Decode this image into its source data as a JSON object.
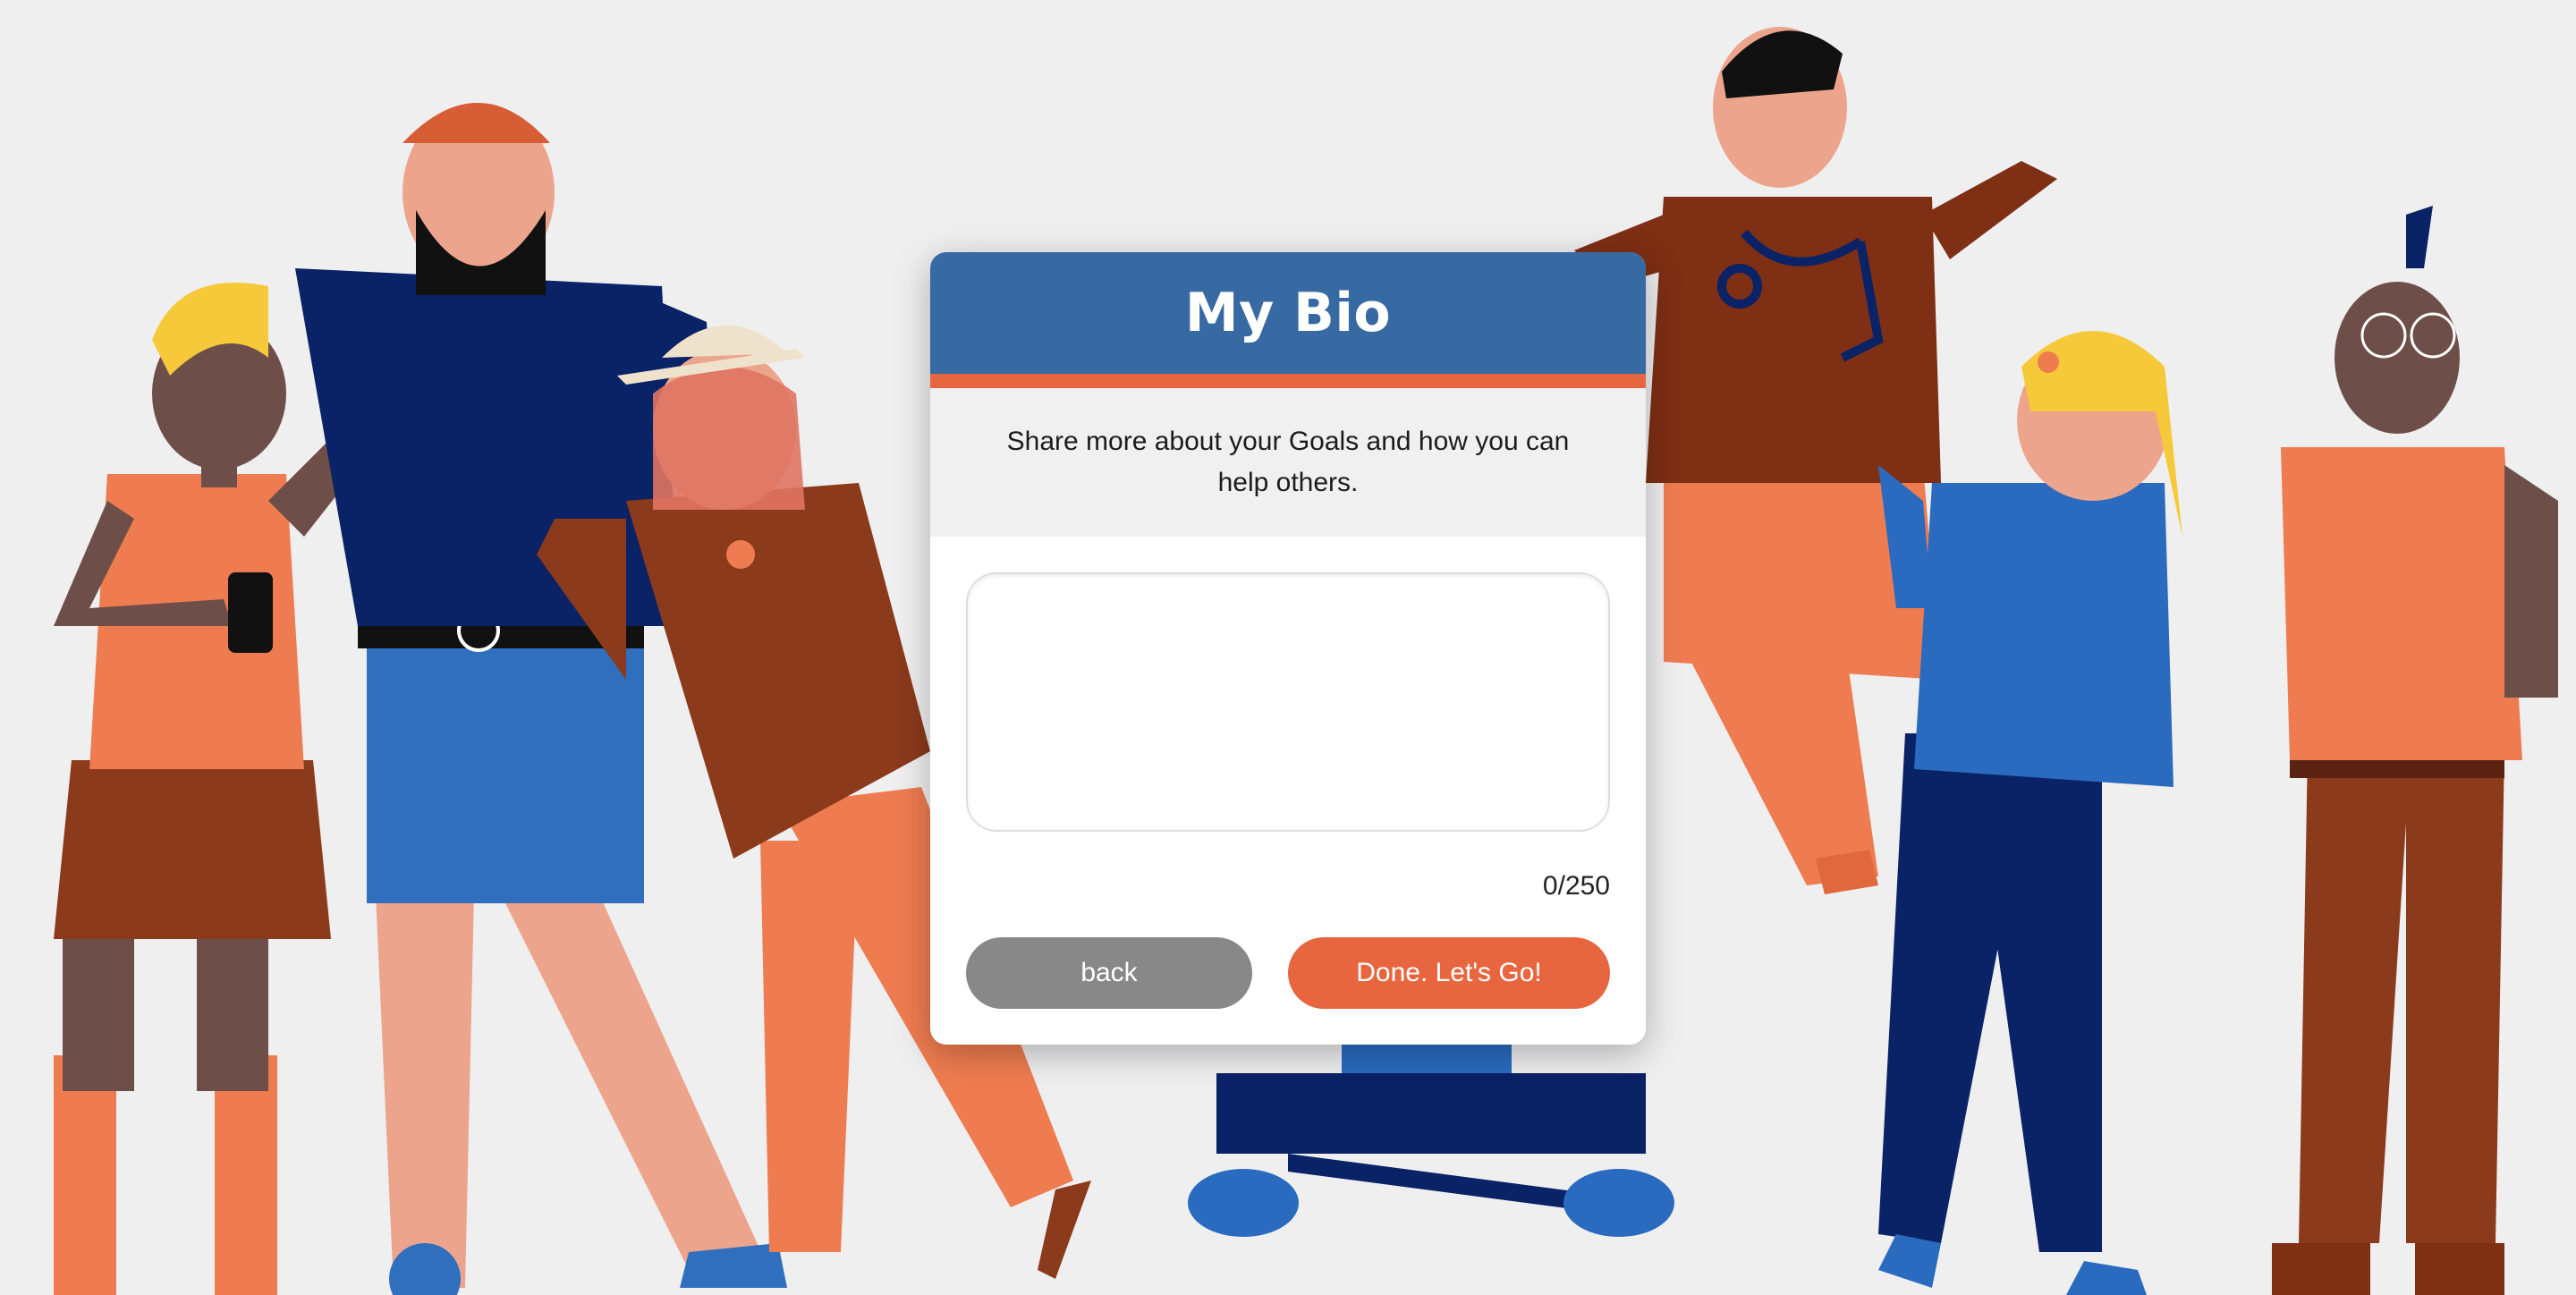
{
  "modal": {
    "title": "My Bio",
    "subtitle": "Share more about your Goals and how you can help others.",
    "bio_value": "",
    "char_count": "0/250",
    "back_label": "back",
    "done_label": "Done. Let's Go!"
  },
  "colors": {
    "header": "#3769a3",
    "accent": "#e8663f",
    "back_button": "#888888",
    "background": "#efeff0"
  },
  "illustration": {
    "description_icon": "group-of-people-illustration"
  }
}
